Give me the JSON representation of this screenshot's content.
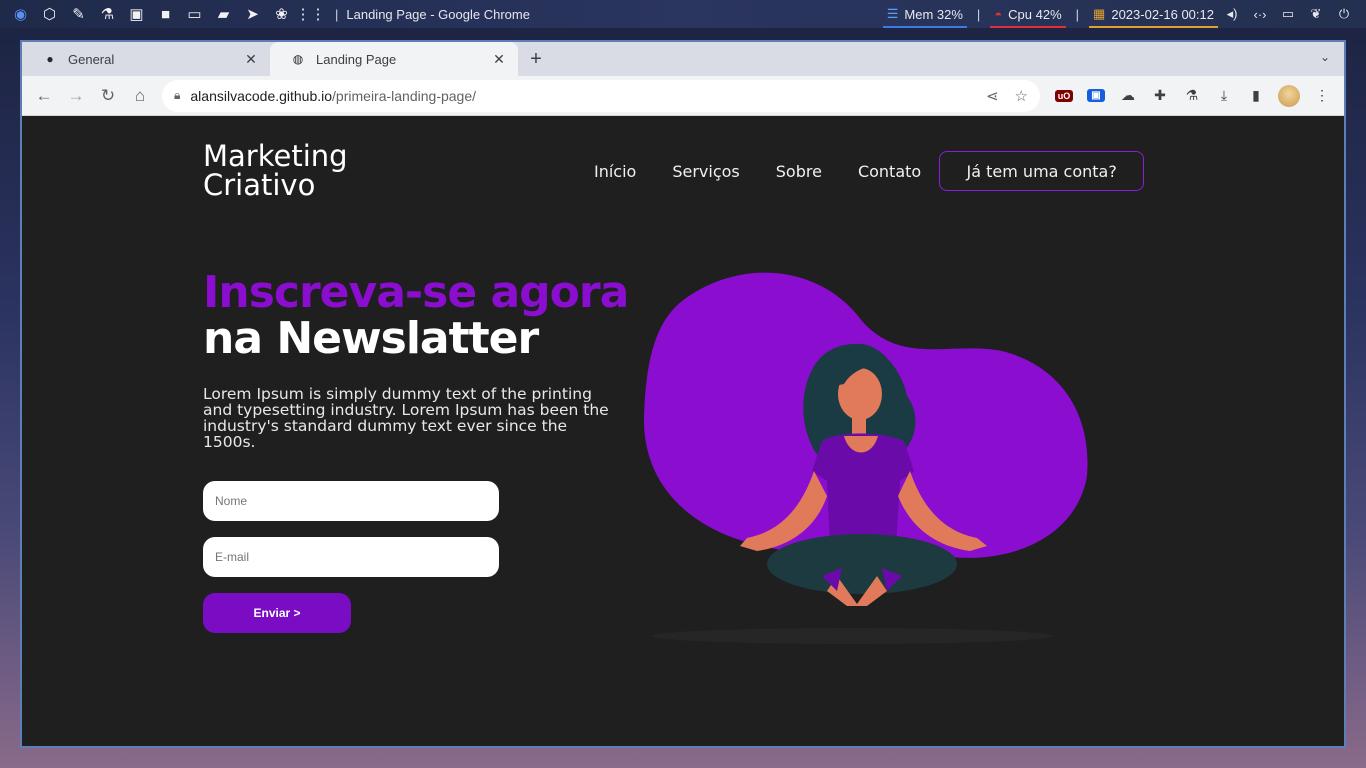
{
  "taskbar": {
    "window_title": "Landing Page - Google Chrome",
    "separator": "|",
    "icons": [
      "globe-icon",
      "codepen-icon",
      "eyedropper-icon",
      "flask-icon",
      "image-icon",
      "video-icon",
      "laptop-icon",
      "folder-icon",
      "telegram-icon",
      "paw-icon",
      "apps-grid-icon"
    ],
    "mem": "Mem 32%",
    "cpu": "Cpu  42%",
    "datetime": "2023-02-16 00:12",
    "mem_color": "#3d7be0",
    "cpu_color": "#e0303a",
    "date_color": "#e0a030"
  },
  "browser": {
    "tabs": [
      {
        "label": "General",
        "icon": "github-icon"
      },
      {
        "label": "Landing Page",
        "icon": "globe-icon"
      }
    ],
    "url_host": "alansilvacode.github.io",
    "url_path": "/primeira-landing-page/"
  },
  "page": {
    "logo_line1": "Marketing",
    "logo_line2": "Criativo",
    "nav": [
      "Início",
      "Serviços",
      "Sobre",
      "Contato"
    ],
    "login_button": "Já tem uma conta?",
    "title_line1": "Inscreva-se agora",
    "title_line2": "na Newslatter",
    "description": "Lorem Ipsum is simply dummy text of the printing and typesetting industry. Lorem Ipsum has been the industry's standard dummy text ever since the 1500s.",
    "name_placeholder": "Nome",
    "email_placeholder": "E-mail",
    "send_button": "Enviar >",
    "accent_color": "#8a0dd0"
  }
}
